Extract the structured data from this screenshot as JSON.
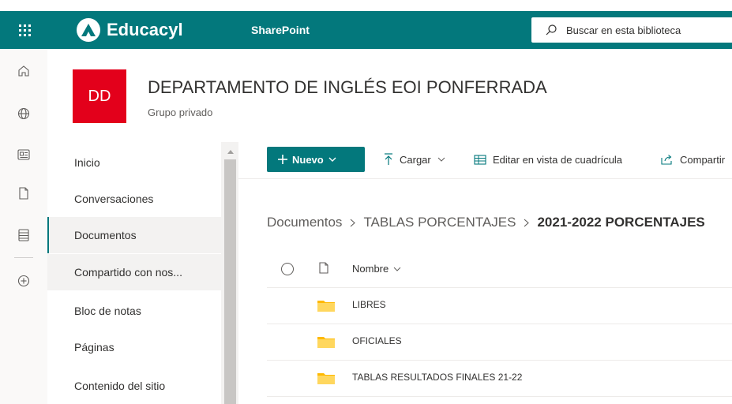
{
  "topbar": {
    "brand_name": "Educacyl",
    "product_link": "SharePoint",
    "search_placeholder": "Buscar en esta biblioteca"
  },
  "site": {
    "logo_initials": "DD",
    "title": "DEPARTAMENTO DE INGLÉS EOI PONFERRADA",
    "subtitle": "Grupo privado",
    "logo_color": "#e3001b"
  },
  "rail": {
    "icons": [
      "home-icon",
      "globe-icon",
      "news-icon",
      "file-icon",
      "lists-icon",
      "add-icon"
    ]
  },
  "leftnav": {
    "items": [
      {
        "label": "Inicio"
      },
      {
        "label": "Conversaciones"
      },
      {
        "label": "Documentos"
      },
      {
        "label": "Compartido con nos..."
      },
      {
        "label": "Bloc de notas"
      },
      {
        "label": "Páginas"
      },
      {
        "label": "Contenido del sitio"
      }
    ],
    "active_index": 2
  },
  "commandbar": {
    "new_label": "Nuevo",
    "upload_label": "Cargar",
    "grid_edit_label": "Editar en vista de cuadrícula",
    "share_label": "Compartir"
  },
  "breadcrumb": {
    "items": [
      "Documentos",
      "TABLAS PORCENTAJES",
      "2021-2022 PORCENTAJES"
    ]
  },
  "list": {
    "name_header": "Nombre",
    "rows": [
      {
        "name": "LIBRES"
      },
      {
        "name": "OFICIALES"
      },
      {
        "name": "TABLAS RESULTADOS FINALES 21-22"
      }
    ]
  },
  "colors": {
    "accent": "#03787c",
    "folder": "#ffcd3c"
  }
}
